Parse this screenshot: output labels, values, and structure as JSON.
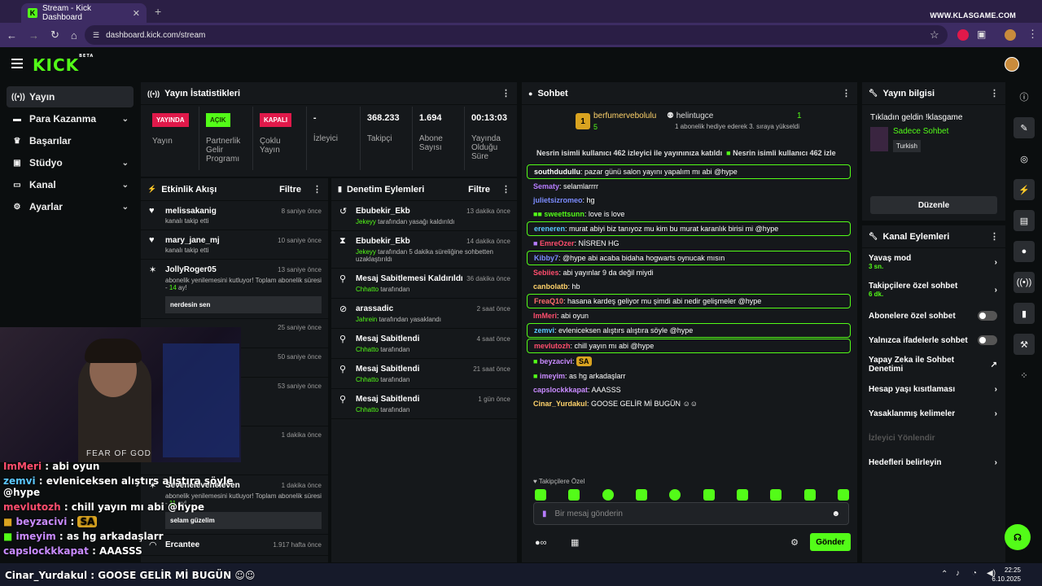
{
  "browser": {
    "tab_title": "Stream - Kick Dashboard",
    "url": "dashboard.kick.com/stream",
    "watermark": "WWW.KLASGAME.COM"
  },
  "app": {
    "logo": "KICK",
    "logo_sup": "BETA"
  },
  "sidebar": {
    "items": [
      {
        "label": "Yayın",
        "icon": "broadcast-icon"
      },
      {
        "label": "Para Kazanma",
        "icon": "money-icon"
      },
      {
        "label": "Başarılar",
        "icon": "trophy-icon"
      },
      {
        "label": "Stüdyo",
        "icon": "studio-icon"
      },
      {
        "label": "Kanal",
        "icon": "channel-icon"
      },
      {
        "label": "Ayarlar",
        "icon": "gear-icon"
      }
    ]
  },
  "stats": {
    "title": "Yayın İstatistikleri",
    "items": [
      {
        "badge": "YAYINDA",
        "badge_color": "#e0194a",
        "label": "Yayın"
      },
      {
        "badge": "AÇIK",
        "badge_color": "#53fc18",
        "label": "Partnerlik Gelir Programı"
      },
      {
        "badge": "KAPALI",
        "badge_color": "#e0194a",
        "label": "Çoklu Yayın"
      },
      {
        "value": "-",
        "label": "İzleyici"
      },
      {
        "value": "368.233",
        "label": "Takipçi"
      },
      {
        "value": "1.694",
        "label": "Abone Sayısı"
      },
      {
        "value": "00:13:03",
        "label": "Yayında Olduğu Süre"
      }
    ]
  },
  "activity": {
    "title": "Etkinlik Akışı",
    "filter": "Filtre",
    "events": [
      {
        "name": "melissakanig",
        "time": "8 saniye önce",
        "sub": "kanalı takip etti"
      },
      {
        "name": "mary_jane_mj",
        "time": "10 saniye önce",
        "sub": "kanalı takip etti"
      },
      {
        "name": "JollyRoger05",
        "time": "13 saniye önce",
        "sub_a": "abonelik yenilemesini kutluyor! Toplam abonelik süresi - ",
        "sub_b": "14",
        "sub_c": " ay!",
        "quote": "nerdesin sen"
      },
      {
        "name": "Seveneleveneleven",
        "time": "1 dakika önce",
        "sub_a": "abonelik yenilemesini kutluyor! Toplam abonelik süresi - ",
        "sub_b": "11",
        "sub_c": " ay!",
        "quote": "selam güzelim"
      },
      {
        "name": "Ercantee",
        "time": "1.917 hafta önce"
      }
    ],
    "hidden_times": [
      "25 saniye önce",
      "50 saniye önce",
      "53 saniye önce",
      "1 dakika önce"
    ],
    "hidden_sub": "utluyor! Toplam abonelik"
  },
  "moderation": {
    "title": "Denetim Eylemleri",
    "filter": "Filtre",
    "items": [
      {
        "name": "Ebubekir_Ekb",
        "time": "13 dakika önce",
        "actor": "Jekeyy",
        "desc": " tarafından yasağı kaldırıldı"
      },
      {
        "name": "Ebubekir_Ekb",
        "time": "14 dakika önce",
        "actor": "Jekeyy",
        "desc": " tarafından 5 dakika süreliğine sohbetten uzaklaştırıldı"
      },
      {
        "name": "Mesaj Sabitlemesi Kaldırıldı",
        "time": "36 dakika önce",
        "actor": "Chhatto",
        "desc": " tarafından"
      },
      {
        "name": "arassadic",
        "time": "2 saat önce",
        "actor": "Jahrein",
        "desc": " tarafından yasaklandı"
      },
      {
        "name": "Mesaj Sabitlendi",
        "time": "4 saat önce",
        "actor": "Chhatto",
        "desc": " tarafından"
      },
      {
        "name": "Mesaj Sabitlendi",
        "time": "21 saat önce",
        "actor": "Chhatto",
        "desc": " tarafından"
      },
      {
        "name": "Mesaj Sabitlendi",
        "time": "1 gün önce",
        "actor": "Chhatto",
        "desc": " tarafından"
      }
    ]
  },
  "chat": {
    "title": "Sohbet",
    "top_user": "berfumervebolulu",
    "top_count": "5",
    "gift_user": "helintugce",
    "gift_count": "1",
    "gift_text": "1 abonelik hediye ederek 3. sıraya yükseldi",
    "banner": "Nesrin isimli kullanıcı 462 izleyici ile yayınınıza katıldı",
    "banner2": "Nesrin isimli kullanıcı 462 izle",
    "messages": [
      {
        "user": "southdudullu",
        "color": "#ffffff",
        "text": ": pazar günü salon yayını yapalım mı abi @hype",
        "hl": true
      },
      {
        "user": "Sematy",
        "color": "#b77cff",
        "text": ": selamlarrrr",
        "hl": false
      },
      {
        "user": "julietsizromeo",
        "color": "#7c8cff",
        "text": ": hg",
        "hl": false
      },
      {
        "user": "sweettsunn",
        "color": "#53fc18",
        "text": ": love is love",
        "hl": false
      },
      {
        "user": "ereneren",
        "color": "#5bc8ff",
        "text": ": murat abiyi biz tanıyoz mu kim bu murat karanlık birisi mi @hype",
        "hl": true
      },
      {
        "user": "EmreOzer",
        "color": "#ff4d6d",
        "text": ": NİSREN HG",
        "hl": false
      },
      {
        "user": "Kibby7",
        "color": "#7c8cff",
        "text": ": @hype abi acaba bidaha hogwarts oynucak mısın",
        "hl": true
      },
      {
        "user": "Sebiies",
        "color": "#ff4d6d",
        "text": ": abi yayınlar 9 da değil miydi",
        "hl": false
      },
      {
        "user": "canbolatb",
        "color": "#ffd36b",
        "text": ": hb",
        "hl": false
      },
      {
        "user": "FreaQ10",
        "color": "#ff6b6b",
        "text": ": hasana kardeş geliyor mu şimdi abi nedir gelişmeler @hype",
        "hl": true
      },
      {
        "user": "ImMeri",
        "color": "#ff4d6d",
        "text": ": abi oyun",
        "hl": false
      },
      {
        "user": "zemvi",
        "color": "#5bc8ff",
        "text": ": evleniceksen alıştırs alıştıra söyle @hype",
        "hl": true
      },
      {
        "user": "mevlutozh",
        "color": "#ff4d6d",
        "text": ": chill yayın mı abi @hype",
        "hl": true
      },
      {
        "user": "beyzacivi",
        "color": "#c98bff",
        "text": ": ",
        "hl": false
      },
      {
        "user": "imeyim",
        "color": "#c98bff",
        "text": ": as hg arkadaşlarr",
        "hl": false
      },
      {
        "user": "capslockkkapat",
        "color": "#c98bff",
        "text": ": AAASSS",
        "hl": false
      },
      {
        "user": "Cinar_Yurdakul",
        "color": "#ffd36b",
        "text": ": GOOSE GELİR Mİ BUGÜN",
        "hl": false
      }
    ],
    "followers_only": "Takipçilere Özel",
    "placeholder": "Bir mesaj gönderin",
    "send": "Gönder"
  },
  "stream_info": {
    "title": "Yayın bilgisi",
    "stream_title": "Tıkladın geldin !klasgame",
    "category": "Sadece Sohbet",
    "language": "Turkish",
    "edit": "Düzenle"
  },
  "channel_actions": {
    "title": "Kanal Eylemleri",
    "items": [
      {
        "label": "Yavaş mod",
        "sub": "3 sn.",
        "type": "chev"
      },
      {
        "label": "Takipçilere özel sohbet",
        "sub": "6 dk.",
        "type": "chev"
      },
      {
        "label": "Abonelere özel sohbet",
        "sub": "",
        "type": "toggle"
      },
      {
        "label": "Yalnızca ifadelerle sohbet",
        "sub": "",
        "type": "toggle"
      },
      {
        "label": "Yapay Zeka ile Sohbet Denetimi",
        "sub": "",
        "type": "ext"
      },
      {
        "label": "Hesap yaşı kısıtlaması",
        "sub": "",
        "type": "chev"
      },
      {
        "label": "Yasaklanmış kelimeler",
        "sub": "",
        "type": "chev"
      },
      {
        "label": "İzleyici Yönlendir",
        "sub": "",
        "type": "disabled"
      },
      {
        "label": "Hedefleri belirleyin",
        "sub": "",
        "type": "chev"
      }
    ]
  },
  "webcam": {
    "shirt": "FEAR OF GOD"
  },
  "overlay": [
    {
      "user": "ImMeri",
      "color": "#ff4d6d",
      "text": " : abi oyun"
    },
    {
      "user": "zemvi",
      "color": "#5bc8ff",
      "text": " : evleniceksen alıştırs alıştıra söyle @hype"
    },
    {
      "user": "mevlutozh",
      "color": "#ff4d6d",
      "text": " : chill yayın mı abi @hype"
    },
    {
      "user": "beyzacivi",
      "color": "#c98bff",
      "text": " : "
    },
    {
      "user": "imeyim",
      "color": "#c98bff",
      "text": " : as hg arkadaşlarr"
    },
    {
      "user": "capslockkkapat",
      "color": "#c98bff",
      "text": " : AAASSS"
    },
    {
      "user": "Cinar_Yurdakul",
      "color": "#ffffff",
      "text": " : GOOSE GELİR Mİ BUGÜN"
    }
  ],
  "taskbar": {
    "time": "22:25",
    "date": "6.10.2025"
  }
}
